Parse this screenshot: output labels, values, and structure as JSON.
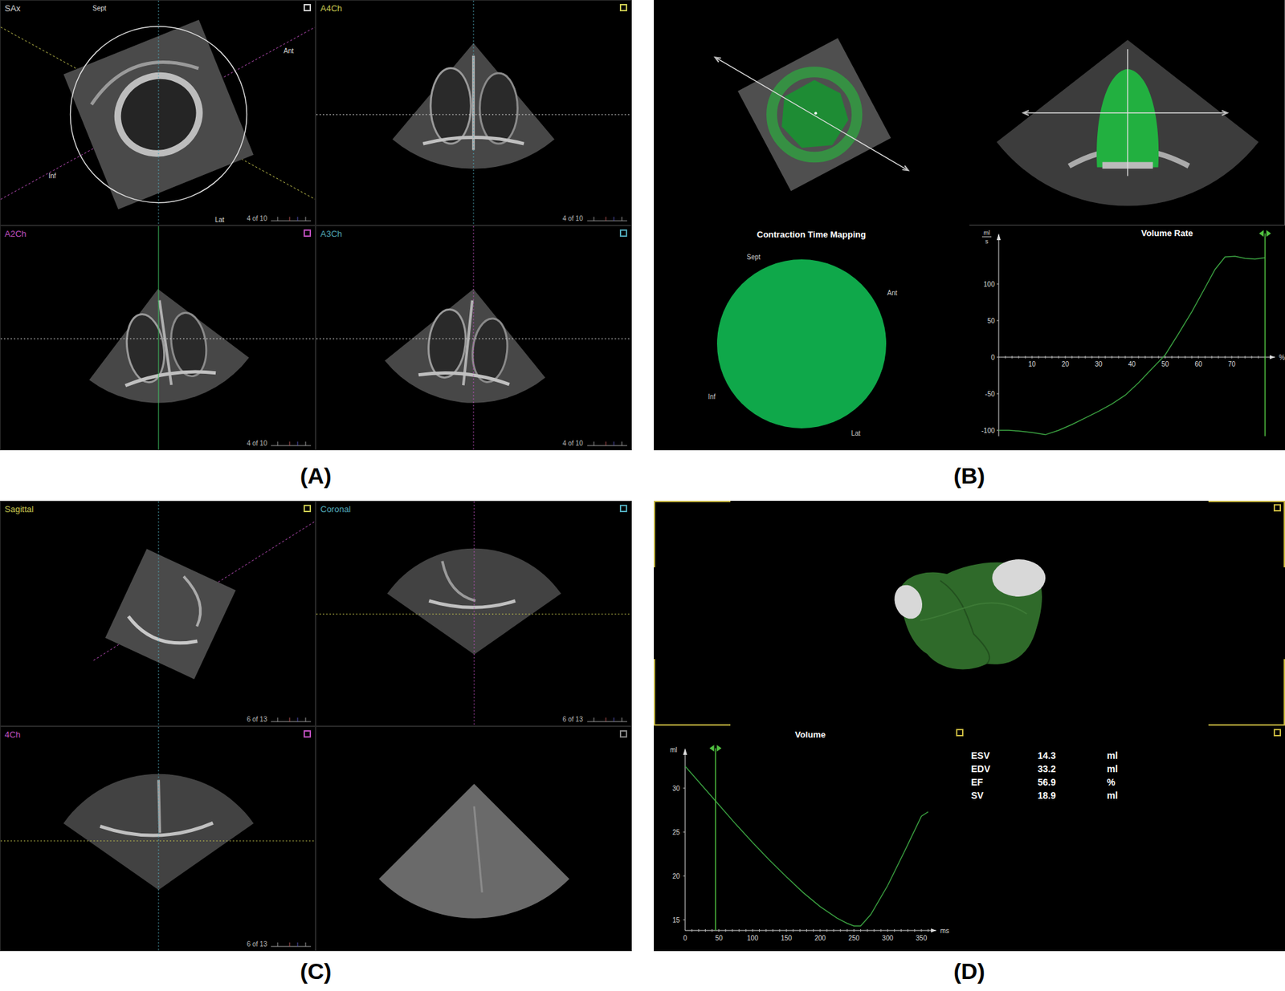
{
  "panel_a": {
    "label": "(A)",
    "views": [
      {
        "name": "SAx",
        "color": "#d0d0d0",
        "frame": "4 of 10"
      },
      {
        "name": "A4Ch",
        "color": "#c8c850",
        "frame": "4 of 10"
      },
      {
        "name": "A2Ch",
        "color": "#c050c0",
        "frame": "4 of 10"
      },
      {
        "name": "A3Ch",
        "color": "#50a8b8",
        "frame": "4 of 10"
      }
    ],
    "orientation": {
      "top": "Sept",
      "right": "Ant",
      "left": "Inf",
      "bottom": "Lat"
    }
  },
  "panel_b": {
    "label": "(B)",
    "map_title": "Contraction Time Mapping",
    "map_orientation": {
      "top": "Sept",
      "right": "Ant",
      "left": "Inf",
      "bottom": "Lat"
    },
    "chart": {
      "title": "Volume Rate",
      "y_unit_top": "ml",
      "y_unit_bottom": "s",
      "x_unit": "%",
      "y_ticks": [
        "100",
        "50",
        "0",
        "-50",
        "-100"
      ],
      "x_ticks": [
        "10",
        "20",
        "30",
        "40",
        "50",
        "60",
        "70"
      ],
      "x": [
        0,
        3,
        6,
        10,
        14,
        18,
        22,
        26,
        30,
        34,
        38,
        42,
        46,
        50,
        54,
        58,
        62,
        65,
        68,
        71,
        74,
        77,
        80
      ],
      "values": [
        -100,
        -100,
        -101,
        -103,
        -106,
        -100,
        -92,
        -83,
        -74,
        -64,
        -52,
        -35,
        -16,
        3,
        32,
        62,
        95,
        120,
        137,
        138,
        135,
        134,
        136
      ],
      "cursor": 80
    }
  },
  "panel_c": {
    "label": "(C)",
    "views": [
      {
        "name": "Sagittal",
        "color": "#c8c850",
        "frame": "6 of 13"
      },
      {
        "name": "Coronal",
        "color": "#50a8b8",
        "frame": "6 of 13"
      },
      {
        "name": "4Ch",
        "color": "#c050c0",
        "frame": "6 of 13"
      }
    ]
  },
  "panel_d": {
    "label": "(D)",
    "chart": {
      "title": "Volume",
      "y_unit": "ml",
      "x_unit": "ms",
      "y_ticks": [
        "30",
        "25",
        "20",
        "15"
      ],
      "x_ticks": [
        "0",
        "50",
        "100",
        "150",
        "200",
        "250",
        "300",
        "350"
      ],
      "x": [
        0,
        25,
        50,
        75,
        100,
        125,
        150,
        175,
        200,
        225,
        240,
        250,
        260,
        275,
        300,
        325,
        350,
        360
      ],
      "values": [
        32.5,
        30.3,
        28.1,
        25.9,
        23.8,
        21.8,
        19.9,
        18.1,
        16.5,
        15.2,
        14.6,
        14.3,
        14.3,
        15.6,
        18.9,
        22.8,
        26.8,
        27.3
      ],
      "cursor": 45
    },
    "stats": [
      {
        "name": "ESV",
        "value": "14.3",
        "unit": "ml"
      },
      {
        "name": "EDV",
        "value": "33.2",
        "unit": "ml"
      },
      {
        "name": "EF",
        "value": "56.9",
        "unit": "%"
      },
      {
        "name": "SV",
        "value": "18.9",
        "unit": "ml"
      }
    ]
  }
}
